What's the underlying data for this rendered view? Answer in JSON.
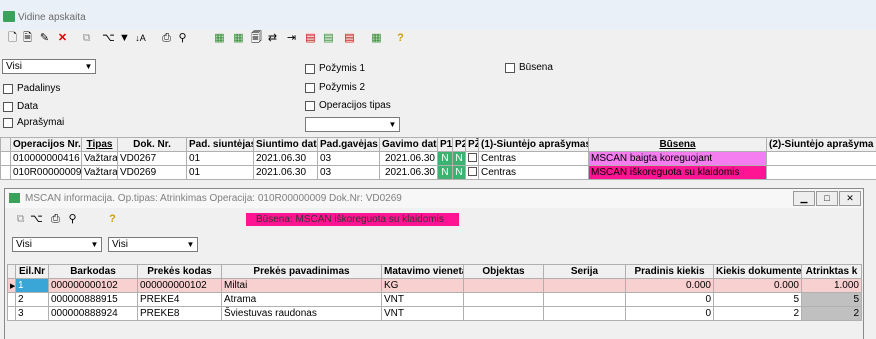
{
  "window": {
    "title": "Vidine apskaita"
  },
  "toolbar_icons": [
    "new-doc-icon",
    "doc-icon",
    "edit-icon",
    "delete-icon",
    "copy-icon",
    "tree-icon",
    "filter-icon",
    "sort-icon",
    "print-icon",
    "find-icon",
    "table-add-icon",
    "table-edit-icon",
    "doc-copy-icon",
    "link-icon",
    "move-icon",
    "cart-red-icon",
    "cart-green-icon",
    "cart-icon",
    "table-green-icon",
    "help-icon"
  ],
  "filters": {
    "combo_value": "Visi",
    "padalinys": "Padalinys",
    "data": "Data",
    "aprasymai": "Aprašymai",
    "pozymis1": "Požymis 1",
    "pozymis2": "Požymis 2",
    "operacijos_tipas": "Operacijos tipas",
    "busena": "Būsena",
    "op_tipas_value": ""
  },
  "main_table": {
    "headers": [
      "Operacijos Nr.",
      "Tipas",
      "Dok. Nr.",
      "Pad. siuntėjas",
      "Siuntimo data",
      "Pad.gavėjas",
      "Gavimo data",
      "P1",
      "P2",
      "PŽ",
      "(1)-Siuntėjo aprašymas",
      "Būsena",
      "(2)-Siuntėjo aprašyma"
    ],
    "rows": [
      {
        "op": "010000000416",
        "tipas": "Važtara",
        "dok": "VD0267",
        "pad_s": "01",
        "s_data": "2021.06.30",
        "pad_g": "03",
        "g_data": "2021.06.30",
        "p1": "N",
        "p2": "N",
        "pz": "",
        "apr1": "Centras",
        "busena": "MSCAN baigta koreguojant",
        "apr2": "",
        "busena_color": "#f47ef0"
      },
      {
        "op": "010R00000009",
        "tipas": "Važtara",
        "dok": "VD0269",
        "pad_s": "01",
        "s_data": "2021.06.30",
        "pad_g": "03",
        "g_data": "2021.06.30",
        "p1": "N",
        "p2": "N",
        "pz": "",
        "apr1": "Centras",
        "busena": "MSCAN iškoreguota su klaidomis",
        "apr2": "",
        "busena_color": "#ff1493"
      }
    ]
  },
  "sub_window": {
    "title": "MSCAN informacija. Op.tipas: Atrinkimas Operacija: 010R00000009 Dok.Nr: VD0269",
    "status": "Būsena: MSCAN iškoreguota su klaidomis",
    "status_color": "#ff1493",
    "combo1": "Visi",
    "combo2": "Visi",
    "headers": [
      "Eil.Nr",
      "Barkodas",
      "Prekės kodas",
      "Prekės pavadinimas",
      "Matavimo vienetas",
      "Objektas",
      "Serija",
      "Pradinis kiekis",
      "Kiekis dokumente",
      "Atrinktas k"
    ],
    "rows": [
      {
        "nr": "1",
        "barkodas": "000000000102",
        "kodas": "000000000102",
        "pav": "Miltai",
        "mv": "KG",
        "obj": "",
        "serija": "",
        "pradinis": "0.000",
        "kiekis": "0.000",
        "atrinktas": "1.000"
      },
      {
        "nr": "2",
        "barkodas": "000000888915",
        "kodas": "PREKE4",
        "pav": "Atrama",
        "mv": "VNT",
        "obj": "",
        "serija": "",
        "pradinis": "0",
        "kiekis": "5",
        "atrinktas": "5"
      },
      {
        "nr": "3",
        "barkodas": "000000888924",
        "kodas": "PREKE8",
        "pav": "Šviestuvas raudonas",
        "mv": "VNT",
        "obj": "",
        "serija": "",
        "pradinis": "0",
        "kiekis": "2",
        "atrinktas": "2"
      }
    ]
  }
}
